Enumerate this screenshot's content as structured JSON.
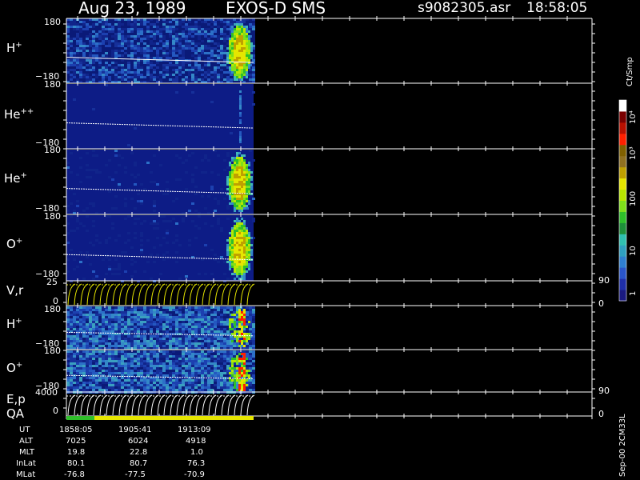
{
  "header": {
    "date": "Aug 23, 1989",
    "instrument": "EXOS-D SMS",
    "file": "s9082305.asr",
    "time": "18:58:05"
  },
  "colorbar": {
    "unit": "Ct/Smp",
    "tick_labels": [
      "1",
      "10",
      "100",
      "10³",
      "10⁴"
    ],
    "colors": [
      "#1a1a80",
      "#1f2fa8",
      "#2a55c8",
      "#2f7fd0",
      "#2fa0c0",
      "#30c0b0",
      "#1e8f3a",
      "#2fbf2a",
      "#7fdf1a",
      "#b8e600",
      "#e6e600",
      "#bfa000",
      "#907020",
      "#806000",
      "#ff2000",
      "#b81000",
      "#7a0000",
      "#ffffff"
    ]
  },
  "footer": {
    "side_label": "Sep-00 2CM33L",
    "rows": [
      {
        "label": "UT",
        "values": [
          "1858:05",
          "1905:41",
          "1913:09"
        ]
      },
      {
        "label": "ALT",
        "values": [
          "7025",
          "6024",
          "4918"
        ]
      },
      {
        "label": "MLT",
        "values": [
          "19.8",
          "22.8",
          "1.0"
        ]
      },
      {
        "label": "InLat",
        "values": [
          "80.1",
          "80.7",
          "76.3"
        ]
      },
      {
        "label": "MLat",
        "values": [
          "-76.8",
          "-77.5",
          "-70.9"
        ]
      }
    ]
  },
  "chart_data": {
    "type": "heatmap",
    "panels": [
      {
        "id": "h-plus-1",
        "label": "H",
        "sup": "+",
        "ytop": "180",
        "ybot": "−180",
        "ylim": [
          -180,
          180
        ]
      },
      {
        "id": "he-pp",
        "label": "He",
        "sup": "++",
        "ytop": "180",
        "ybot": "−180",
        "ylim": [
          -180,
          180
        ]
      },
      {
        "id": "he-plus",
        "label": "He",
        "sup": "+",
        "ytop": "180",
        "ybot": "−180",
        "ylim": [
          -180,
          180
        ]
      },
      {
        "id": "o-plus-1",
        "label": "O",
        "sup": "+",
        "ytop": "180",
        "ybot": "−180",
        "ylim": [
          -180,
          180
        ]
      },
      {
        "id": "vr",
        "label": "V,r",
        "sup": "",
        "ytop": "25",
        "ybot": "0",
        "ylim": [
          0,
          25
        ],
        "right_top": "90",
        "right_bot": "0"
      },
      {
        "id": "h-plus-2",
        "label": "H",
        "sup": "+",
        "ytop": "180",
        "ybot": "−180",
        "ylim": [
          -180,
          180
        ]
      },
      {
        "id": "o-plus-2",
        "label": "O",
        "sup": "+",
        "ytop": "180",
        "ybot": "−180",
        "ylim": [
          -180,
          180
        ]
      },
      {
        "id": "ep",
        "label": "E,p",
        "sup": "",
        "ytop": "4000",
        "ybot": "0",
        "ylim": [
          0,
          4000
        ],
        "right_top": "90",
        "right_bot": "0"
      }
    ],
    "qa_label": "QA"
  }
}
